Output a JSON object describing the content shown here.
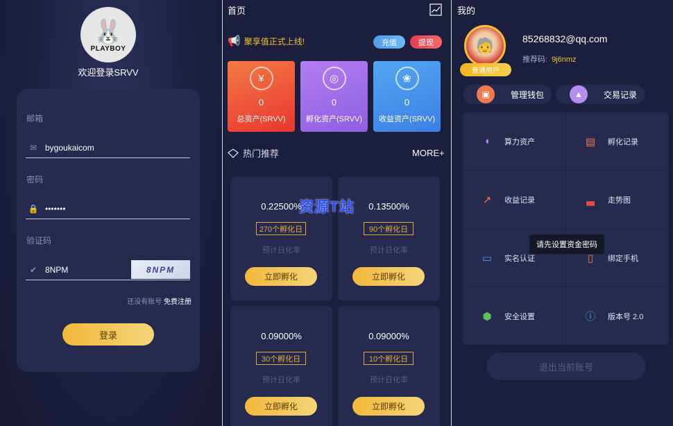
{
  "login": {
    "brand": "PLAYBOY",
    "welcome": "欢迎登录SRVV",
    "email_label": "邮箱",
    "email_value": "bygoukaicom",
    "password_label": "密码",
    "password_value": "•••••••",
    "captcha_label": "验证码",
    "captcha_value": "8NPM",
    "captcha_image_text": "8NPM",
    "register_prompt": "还没有账号",
    "register_link": "免费注册",
    "login_button": "登录"
  },
  "home": {
    "title": "首页",
    "notice": "聚享值正式上线!",
    "recharge": "充值",
    "withdraw": "提现",
    "assets": [
      {
        "value": "0",
        "label": "总资产(SRVV)",
        "icon": "yen-icon"
      },
      {
        "value": "0",
        "label": "孵化资产(SRVV)",
        "icon": "circles-icon"
      },
      {
        "value": "0",
        "label": "收益资产(SRVV)",
        "icon": "molecule-icon"
      }
    ],
    "hot_title": "热门推荐",
    "more": "MORE+",
    "products": [
      {
        "rate": "0.22500%",
        "days": "270个孵化日",
        "est": "预计日化率",
        "button": "立即孵化"
      },
      {
        "rate": "0.13500%",
        "days": "90个孵化日",
        "est": "预计日化率",
        "button": "立即孵化"
      },
      {
        "rate": "0.09000%",
        "days": "30个孵化日",
        "est": "预计日化率",
        "button": "立即孵化"
      },
      {
        "rate": "0.09000%",
        "days": "10个孵化日",
        "est": "预计日化率",
        "button": "立即孵化"
      }
    ],
    "watermark": "资源T站"
  },
  "mine": {
    "title": "我的",
    "user_tag": "普通用户",
    "email": "85268832@qq.com",
    "ref_label": "推荐码:",
    "ref_code": "9j6nmz",
    "quick": [
      {
        "label": "管理钱包",
        "icon": "wallet-icon"
      },
      {
        "label": "交易记录",
        "icon": "bag-icon"
      }
    ],
    "menu": [
      {
        "label": "算力资产",
        "icon": "piggy-bank-icon",
        "color": "#b68ef0"
      },
      {
        "label": "孵化记录",
        "icon": "receipt-icon",
        "color": "#f07a4d"
      },
      {
        "label": "收益记录",
        "icon": "trend-icon",
        "color": "#f07a4d"
      },
      {
        "label": "走势图",
        "icon": "chart-icon",
        "color": "#e84a4a"
      },
      {
        "label": "实名认证",
        "icon": "id-card-icon",
        "color": "#4f9ce8"
      },
      {
        "label": "绑定手机",
        "icon": "phone-icon",
        "color": "#f07a4d"
      },
      {
        "label": "安全设置",
        "icon": "shield-icon",
        "color": "#5cc05c"
      },
      {
        "label": "版本号 2.0",
        "icon": "info-icon",
        "color": "#4f9ce8"
      }
    ],
    "tooltip": "请先设置资金密码",
    "logout": "退出当前账号"
  }
}
